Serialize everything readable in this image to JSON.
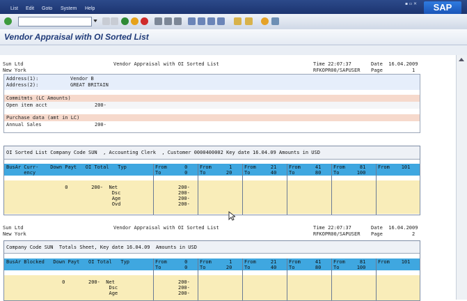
{
  "menu": [
    "List",
    "Edit",
    "Goto",
    "System",
    "Help"
  ],
  "logo_text": "SAP",
  "window_title": "Vendor Appraisal with OI Sorted List",
  "report1": {
    "company": "Sun Ltd",
    "city": "New York",
    "title": "Vendor Appraisal with OI Sorted List",
    "time": "Time 22:07:37",
    "date": "Date  16.04.2009",
    "user": "RFKOPR00/SAPUSER",
    "page": "Page          1"
  },
  "address": {
    "l1": "Address(1):",
    "v1": "Vendor B",
    "l2": "Address(2):",
    "v2": "GREAT BRITAIN"
  },
  "commitments": {
    "title": "Commitmts (LC Amounts)",
    "label": "Open item acct",
    "value": "200-"
  },
  "purchase": {
    "title": "Purchase data (amt in LC)",
    "label": "Annual Sales",
    "value": "200-"
  },
  "table1": {
    "caption": "OI Sorted List Company Code SUN  , Accounting Clerk  , Customer 0000400002 Key date 16.04.09 Amounts in USD",
    "h1": "BusAr Curr-    Down Payt   OI Total   Typ",
    "h2": "      ency",
    "cols": [
      {
        "from": "From      0",
        "to": "To        0"
      },
      {
        "from": "From      1",
        "to": "To       20"
      },
      {
        "from": "From     21",
        "to": "To       40"
      },
      {
        "from": "From     41",
        "to": "To       80"
      },
      {
        "from": "From     81",
        "to": "To      100"
      },
      {
        "from": "From    101",
        "to": ""
      }
    ],
    "row_left": "                    0        200-  Net\n                                    Dsc\n                                    Age\n                                    Ovd",
    "row_col0": "200-\n200-\n200-\n200-"
  },
  "report2": {
    "company": "Sun Ltd",
    "city": "New York",
    "title": "Vendor Appraisal with OI Sorted List",
    "time": "Time 22:07:37",
    "date": "Date  16.04.2009",
    "user": "RFKOPR00/SAPUSER",
    "page": "Page          2"
  },
  "table2": {
    "caption": "Company Code SUN  Totals Sheet, Key date 16.04.09  Amounts in USD",
    "h1": "BusAr Blocked   Down Payt   OI Total   Typ",
    "cols": [
      {
        "from": "From      0",
        "to": "To        0"
      },
      {
        "from": "From      1",
        "to": "To       20"
      },
      {
        "from": "From     21",
        "to": "To       40"
      },
      {
        "from": "From     41",
        "to": "To       80"
      },
      {
        "from": "From     81",
        "to": "To      100"
      },
      {
        "from": "From    101",
        "to": ""
      }
    ],
    "row_left": "                   0        200-  Net\n                                   Dsc\n                                   Age",
    "row_col0": "200-\n200-\n200-"
  }
}
